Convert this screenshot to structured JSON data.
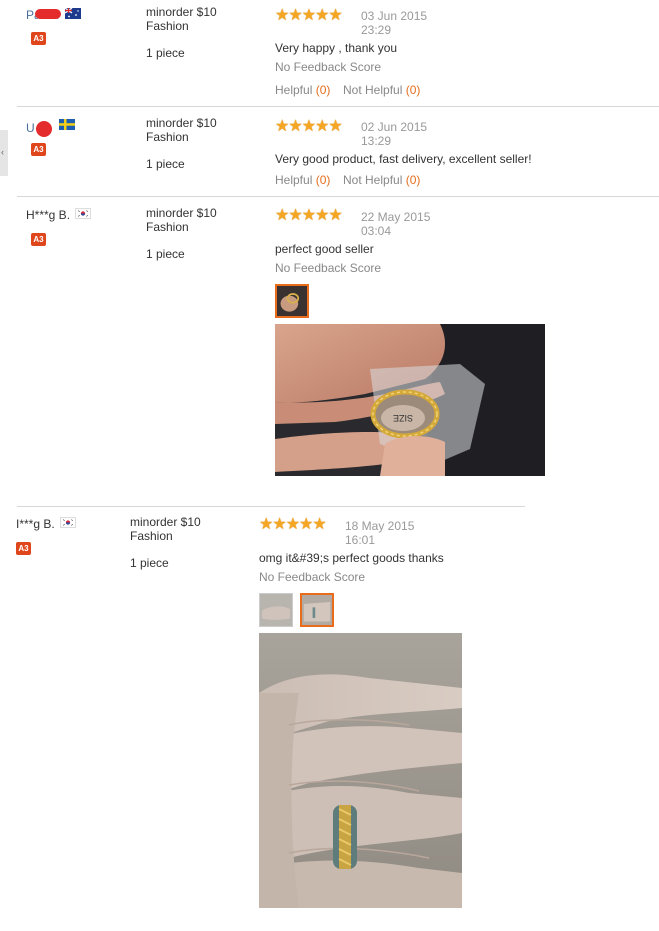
{
  "reviews": [
    {
      "name": "Pa  H.",
      "flag": "AU",
      "badge": "A3",
      "sku_line1": "minorder $10",
      "sku_line2": "Fashion",
      "qty": "1 piece",
      "rating": 5,
      "date": "03 Jun 2015",
      "time": "23:29",
      "comment": "Very happy , thank you",
      "feedback": "No Feedback Score",
      "helpful_label": "Helpful",
      "helpful_count": "(0)",
      "not_helpful_label": "Not Helpful",
      "not_helpful_count": "(0)"
    },
    {
      "name": "U  l.",
      "flag": "SE",
      "badge": "A3",
      "sku_line1": "minorder $10",
      "sku_line2": "Fashion",
      "qty": "1 piece",
      "rating": 5,
      "date": "02 Jun 2015",
      "time": "13:29",
      "comment": "Very good product, fast delivery, excellent seller!",
      "helpful_label": "Helpful",
      "helpful_count": "(0)",
      "not_helpful_label": "Not Helpful",
      "not_helpful_count": "(0)"
    },
    {
      "name": "H***g B.",
      "flag": "KR",
      "badge": "A3",
      "sku_line1": "minorder $10",
      "sku_line2": "Fashion",
      "qty": "1 piece",
      "rating": 5,
      "date": "22 May 2015",
      "time": "03:04",
      "comment": "perfect good seller",
      "feedback": "No Feedback Score"
    },
    {
      "name": "I***g B.",
      "flag": "KR",
      "badge": "A3",
      "sku_line1": "minorder $10",
      "sku_line2": "Fashion",
      "qty": "1 piece",
      "rating": 5,
      "date": "18 May 2015",
      "time": "16:01",
      "comment": "omg it&#39;s perfect goods thanks",
      "feedback": "No Feedback Score"
    }
  ],
  "colors": {
    "star": "#f5a623",
    "accent": "#e96b1c",
    "badge": "#e0461c"
  },
  "icons": {
    "star": "star-icon",
    "flag": "flag-icon",
    "side_tab": "chevron-left-icon"
  },
  "side_tab_glyph": "‹"
}
